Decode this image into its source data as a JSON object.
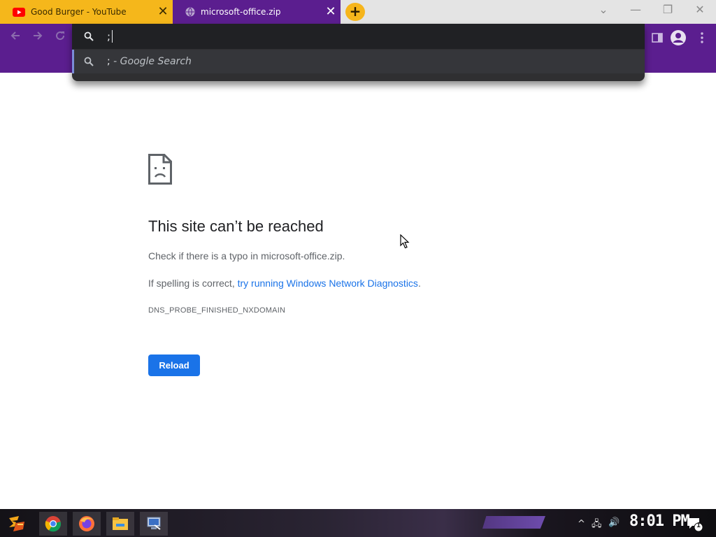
{
  "browser": {
    "tabs": [
      {
        "title": "Good Burger - YouTube",
        "favicon": "youtube-icon",
        "close": "✕"
      },
      {
        "title": "microsoft-office.zip",
        "favicon": "globe-icon",
        "close": "✕"
      }
    ],
    "new_tab": "+",
    "window_controls": {
      "tab_search": "⌄",
      "minimize": "—",
      "restore": "❐",
      "close": "✕"
    },
    "colors": {
      "frame": "#5b1e8f",
      "inactive_tab": "#f5b71b",
      "omnibox": "#202124"
    }
  },
  "omnibox": {
    "input_value": ";",
    "suggestion_query": ";",
    "suggestion_suffix": " - Google Search"
  },
  "error_page": {
    "title": "This site can’t be reached",
    "line1": "Check if there is a typo in microsoft-office.zip.",
    "line2_prefix": "If spelling is correct, ",
    "line2_link": "try running Windows Network Diagnostics",
    "line2_suffix": ".",
    "error_code": "DNS_PROBE_FINISHED_NXDOMAIN",
    "reload_label": "Reload"
  },
  "taskbar": {
    "items": [
      "start-button",
      "chrome-icon",
      "firefox-icon",
      "file-explorer-icon",
      "network-app-icon"
    ],
    "tray": {
      "chevron": "^",
      "network": "🖧",
      "volume": "🔊",
      "notification_count": "1"
    },
    "clock": "8:01 PM"
  }
}
